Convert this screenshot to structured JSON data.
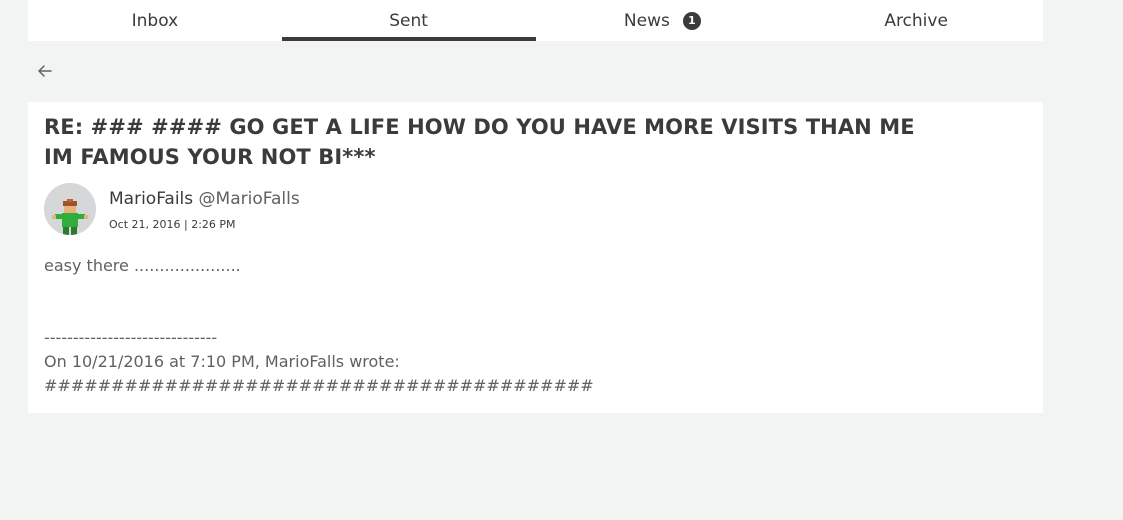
{
  "tabs": [
    {
      "label": "Inbox",
      "active": false
    },
    {
      "label": "Sent",
      "active": true
    },
    {
      "label": "News",
      "badge": "1",
      "active": false
    },
    {
      "label": "Archive",
      "active": false
    }
  ],
  "back_icon": "arrow-left-icon",
  "message": {
    "subject": "RE: ### #### GO GET A LIFE HOW DO YOU HAVE MORE VISITS THAN ME IM FAMOUS YOUR NOT BI***",
    "sender_name": "MarioFails",
    "sender_handle": "@MarioFalls",
    "timestamp": "Oct 21, 2016 | 2:26 PM",
    "body": "easy there .....................\n\n\n------------------------------\nOn 10/21/2016 at 7:10 PM, MarioFalls wrote:\n#########################################"
  },
  "colors": {
    "background": "#f2f3f3",
    "card": "#ffffff",
    "text": "#393b3d",
    "muted_text": "#606162",
    "active_tab_indicator": "#393b3d"
  }
}
